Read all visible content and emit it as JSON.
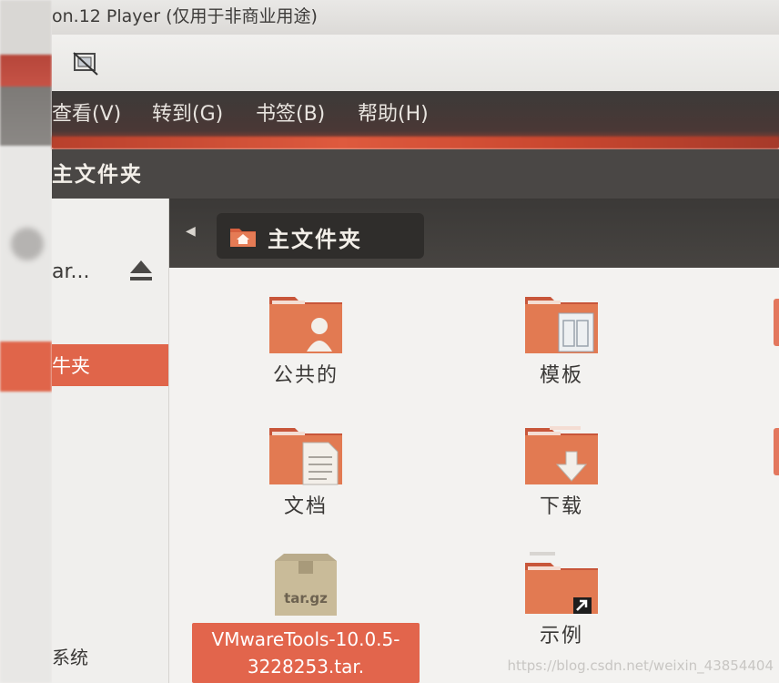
{
  "window": {
    "title": "on.12 Player (仅用于非商业用途)"
  },
  "menu": {
    "items": [
      {
        "label": "查看(V)"
      },
      {
        "label": "转到(G)"
      },
      {
        "label": "书签(B)"
      },
      {
        "label": "帮助(H)"
      }
    ]
  },
  "header": {
    "title": "主文件夹"
  },
  "sidebar": {
    "device_label": "ar...",
    "selected_label": "牛夹",
    "system_label": "系统"
  },
  "pathbar": {
    "current": "主文件夹"
  },
  "files": [
    {
      "name": "公共的",
      "icon": "folder-public-icon"
    },
    {
      "name": "模板",
      "icon": "folder-templates-icon"
    },
    {
      "name": "文档",
      "icon": "folder-documents-icon"
    },
    {
      "name": "下载",
      "icon": "folder-downloads-icon"
    },
    {
      "name": "VMwareTools-10.0.5-3228253.tar.",
      "archive_label": "tar.gz",
      "icon": "archive-tar-gz-icon"
    },
    {
      "name": "示例",
      "icon": "folder-link-icon"
    }
  ],
  "watermark": "https://blog.csdn.net/weixin_43854404",
  "colors": {
    "accent": "#e0654a",
    "menubar": "#3c3a38",
    "folder": "#e0764f"
  }
}
